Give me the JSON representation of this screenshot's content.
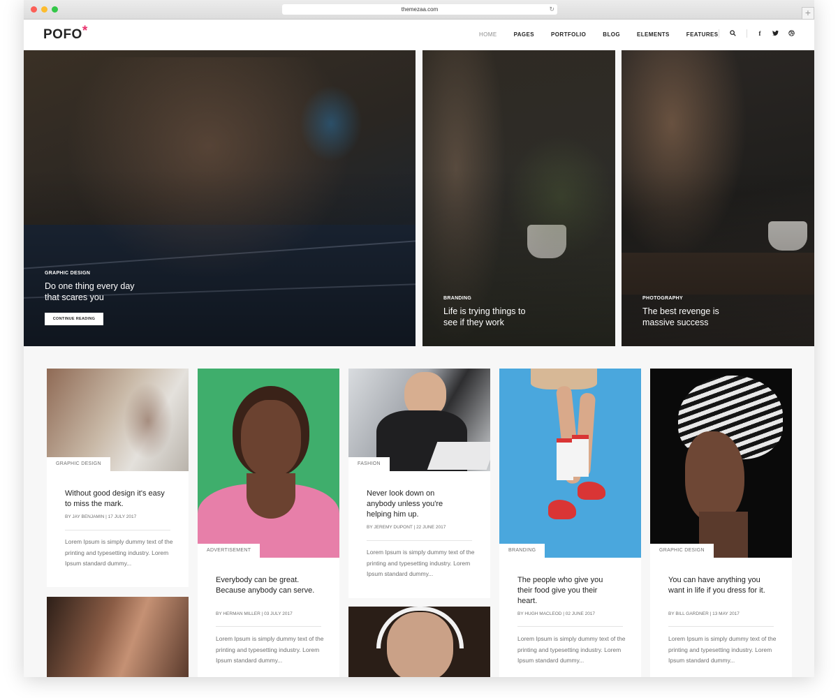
{
  "browser": {
    "url": "themezaa.com"
  },
  "header": {
    "logo": "POFO",
    "nav": [
      "HOME",
      "PAGES",
      "PORTFOLIO",
      "BLOG",
      "ELEMENTS",
      "FEATURES"
    ]
  },
  "hero": [
    {
      "category": "GRAPHIC DESIGN",
      "title": "Do one thing every day that scares you",
      "button": "CONTINUE READING"
    },
    {
      "category": "BRANDING",
      "title": "Life is trying things to see if they work"
    },
    {
      "category": "PHOTOGRAPHY",
      "title": "The best revenge is massive success"
    }
  ],
  "cards": [
    {
      "tag": "GRAPHIC DESIGN",
      "title": "Without good design it's easy to miss the mark.",
      "author": "BY JAY BENJAMIN",
      "date": "17 JULY 2017",
      "excerpt": "Lorem Ipsum is simply dummy text of the printing and typesetting industry. Lorem Ipsum standard dummy..."
    },
    {
      "tag": "ADVERTISEMENT",
      "title": "Everybody can be great. Because anybody can serve.",
      "author": "BY HERMAN MILLER",
      "date": "03 JULY 2017",
      "excerpt": "Lorem Ipsum is simply dummy text of the printing and typesetting industry. Lorem Ipsum standard dummy..."
    },
    {
      "tag": "FASHION",
      "title": "Never look down on anybody unless you're helping him up.",
      "author": "BY JEREMY DUPONT",
      "date": "22 JUNE 2017",
      "excerpt": "Lorem Ipsum is simply dummy text of the printing and typesetting industry. Lorem Ipsum standard dummy..."
    },
    {
      "tag": "BRANDING",
      "title": "The people who give you their food give you their heart.",
      "author": "BY HUGH MACLEOD",
      "date": "02 JUNE 2017",
      "excerpt": "Lorem Ipsum is simply dummy text of the printing and typesetting industry. Lorem Ipsum standard dummy..."
    },
    {
      "tag": "GRAPHIC DESIGN",
      "title": "You can have anything you want in life if you dress for it.",
      "author": "BY BILL GARDNER",
      "date": "13 MAY 2017",
      "excerpt": "Lorem Ipsum is simply dummy text of the printing and typesetting industry. Lorem Ipsum standard dummy..."
    }
  ],
  "colors": {
    "accent": "#e8336d",
    "text": "#232323",
    "muted": "#6f6f6f"
  }
}
